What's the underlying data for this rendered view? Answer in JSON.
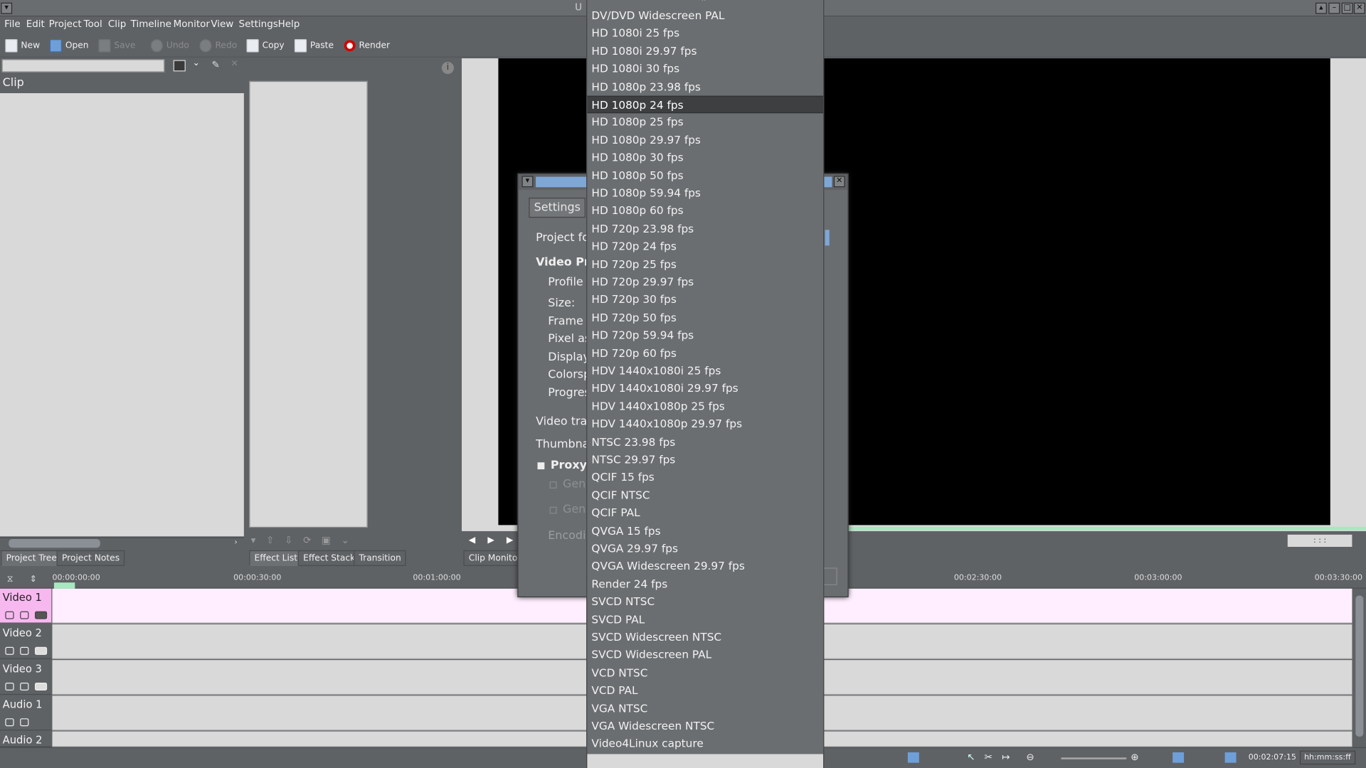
{
  "window": {
    "title_fragment": "U"
  },
  "menu": [
    "File",
    "Edit",
    "Project",
    "Tool",
    "Clip",
    "Timeline",
    "Monitor",
    "View",
    "Settings",
    "Help"
  ],
  "toolbar": {
    "new": "New",
    "open": "Open",
    "save": "Save",
    "undo": "Undo",
    "redo": "Redo",
    "copy": "Copy",
    "paste": "Paste",
    "render": "Render"
  },
  "project_tree": {
    "column_header": "Clip"
  },
  "left_tabs": [
    "Project Tree",
    "Project Notes"
  ],
  "effect_tabs": [
    "Effect List",
    "Effect Stack",
    "Transition"
  ],
  "monitor": {
    "tab": "Clip Monitor",
    "timecode": ": : :"
  },
  "dialog": {
    "tab": "Settings",
    "labels": {
      "project_folder": "Project fo",
      "video_profile": "Video Pro",
      "profile": "Profile",
      "size": "Size:",
      "frame_rate": "Frame r",
      "pixel_aspect": "Pixel as",
      "display": "Display",
      "colorspace": "Colorsp",
      "progressive": "Progres",
      "video_tracks": "Video trac",
      "thumbnails": "Thumbnai",
      "proxy": "Proxy",
      "gen1": "Gene",
      "gen2": "Gene",
      "encoding": "Encodin"
    }
  },
  "profile_dropdown": {
    "selected_index": 5,
    "items": [
      "DV/DVD Widescreen PAL",
      "HD 1080i 25 fps",
      "HD 1080i 29.97 fps",
      "HD 1080i 30 fps",
      "HD 1080p 23.98 fps",
      "HD 1080p 24 fps",
      "HD 1080p 25 fps",
      "HD 1080p 29.97 fps",
      "HD 1080p 30 fps",
      "HD 1080p 50 fps",
      "HD 1080p 59.94 fps",
      "HD 1080p 60 fps",
      "HD 720p 23.98 fps",
      "HD 720p 24 fps",
      "HD 720p 25 fps",
      "HD 720p 29.97 fps",
      "HD 720p 30 fps",
      "HD 720p 50 fps",
      "HD 720p 59.94 fps",
      "HD 720p 60 fps",
      "HDV 1440x1080i 25 fps",
      "HDV 1440x1080i 29.97 fps",
      "HDV 1440x1080p 25 fps",
      "HDV 1440x1080p 29.97 fps",
      "NTSC 23.98 fps",
      "NTSC 29.97 fps",
      "QCIF 15 fps",
      "QCIF NTSC",
      "QCIF PAL",
      "QVGA 15 fps",
      "QVGA 29.97 fps",
      "QVGA Widescreen 29.97 fps",
      "Render 24 fps",
      "SVCD NTSC",
      "SVCD PAL",
      "SVCD Widescreen NTSC",
      "SVCD Widescreen PAL",
      "VCD NTSC",
      "VCD PAL",
      "VGA NTSC",
      "VGA Widescreen NTSC",
      "Video4Linux capture"
    ]
  },
  "timeline": {
    "ticks": [
      "00:00:00:00",
      "00:00:30:00",
      "00:01:00:00",
      "00:02:30:00",
      "00:03:00:00",
      "00:03:30:00"
    ],
    "tracks": [
      "Video 1",
      "Video 2",
      "Video 3",
      "Audio 1",
      "Audio 2"
    ]
  },
  "status": {
    "position": "00:02:07:15",
    "format": "hh:mm:ss:ff"
  },
  "colors": {
    "selected_track": "#ffeeff",
    "track_header_selected": "#f7b8f0",
    "accent": "#a8e8c0"
  }
}
